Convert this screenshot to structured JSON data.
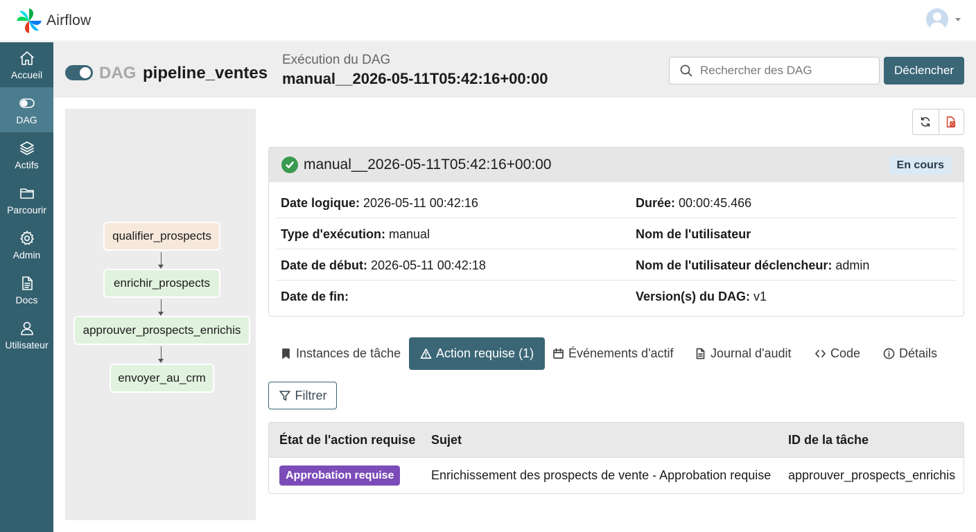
{
  "app": {
    "name": "Airflow"
  },
  "sidebar": {
    "items": [
      {
        "label": "Accueil",
        "icon": "home-icon"
      },
      {
        "label": "DAG",
        "icon": "toggle-icon"
      },
      {
        "label": "Actifs",
        "icon": "layers-icon"
      },
      {
        "label": "Parcourir",
        "icon": "folder-icon"
      },
      {
        "label": "Admin",
        "icon": "gear-icon"
      },
      {
        "label": "Docs",
        "icon": "document-icon"
      },
      {
        "label": "Utilisateur",
        "icon": "user-icon"
      }
    ],
    "active": "DAG"
  },
  "header": {
    "dag_prefix": "DAG",
    "dag_name": "pipeline_ventes",
    "dag_enabled": true,
    "run_label": "Exécution du DAG",
    "run_id": "manual__2026-05-11T05:42:16+00:00",
    "search_placeholder": "Rechercher des DAG",
    "trigger_label": "Déclencher"
  },
  "graph": {
    "nodes": [
      {
        "label": "qualifier_prospects",
        "state_color": "#f7e8dc"
      },
      {
        "label": "enrichir_prospects",
        "state_color": "#e1f2de"
      },
      {
        "label": "approuver_prospects_enrichis",
        "state_color": "#e1f2de"
      },
      {
        "label": "envoyer_au_crm",
        "state_color": "#e1f2de"
      }
    ]
  },
  "run_details": {
    "run_id": "manual__2026-05-11T05:42:16+00:00",
    "state": "success",
    "status": "En cours",
    "fields": {
      "logical_date": {
        "label": "Date logique:",
        "value": "2026-05-11 00:42:16"
      },
      "duration": {
        "label": "Durée:",
        "value": "00:00:45.466"
      },
      "run_type": {
        "label": "Type d'exécution:",
        "value": "manual"
      },
      "username": {
        "label": "Nom de l'utilisateur",
        "value": ""
      },
      "start_date": {
        "label": "Date de début:",
        "value": "2026-05-11 00:42:18"
      },
      "triggering_user": {
        "label": "Nom de l'utilisateur déclencheur:",
        "value": "admin"
      },
      "end_date": {
        "label": "Date de fin:",
        "value": ""
      },
      "dag_version": {
        "label": "Version(s) du DAG:",
        "value": "v1"
      }
    }
  },
  "tabs": [
    {
      "label": "Instances de tâche",
      "icon": "bookmark-icon"
    },
    {
      "label": "Action requise (1)",
      "icon": "warning-icon",
      "active": true
    },
    {
      "label": "Événements d'actif",
      "icon": "calendar-icon"
    },
    {
      "label": "Journal d'audit",
      "icon": "file-icon"
    },
    {
      "label": "Code",
      "icon": "code-icon"
    },
    {
      "label": "Détails",
      "icon": "info-icon"
    }
  ],
  "filter": {
    "label": "Filtrer"
  },
  "table": {
    "columns": [
      "État de l'action requise",
      "Sujet",
      "ID de la tâche"
    ],
    "rows": [
      {
        "state": "Approbation requise",
        "subject": "Enrichissement des prospects de vente - Approbation requise",
        "task_id": "approuver_prospects_enrichis"
      }
    ]
  },
  "colors": {
    "sidebar": "#33606f",
    "sidebar_active": "#4b7d8e",
    "primary": "#3a6676",
    "success": "#3a9a4f",
    "badge_purple": "#7b4cb8",
    "status_badge": "#dbe9f4"
  }
}
